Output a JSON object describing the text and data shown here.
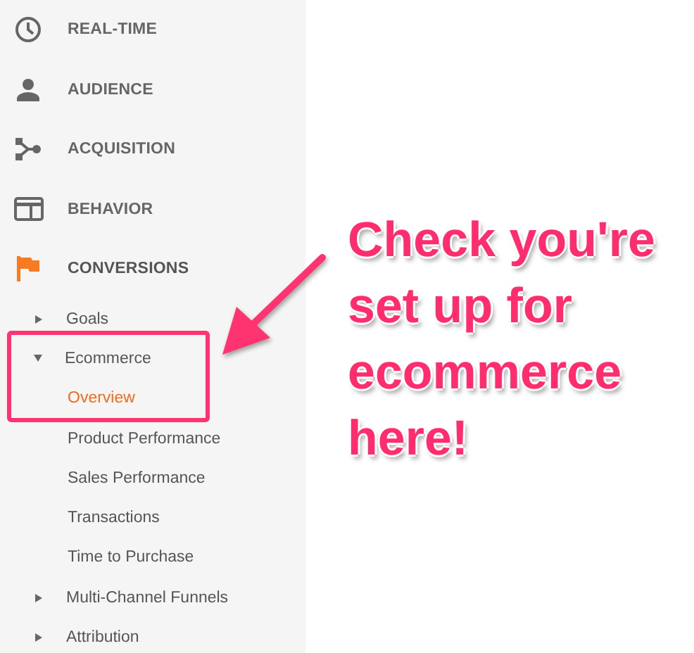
{
  "sidebar": {
    "sections": [
      {
        "label": "REAL-TIME",
        "kind": "clock",
        "selected": false
      },
      {
        "label": "AUDIENCE",
        "kind": "person",
        "selected": false
      },
      {
        "label": "ACQUISITION",
        "kind": "branch",
        "selected": false
      },
      {
        "label": "BEHAVIOR",
        "kind": "window",
        "selected": false
      },
      {
        "label": "CONVERSIONS",
        "kind": "flag",
        "selected": true
      }
    ],
    "items": [
      {
        "label": "Goals",
        "expanded": false
      },
      {
        "label": "Ecommerce",
        "expanded": true,
        "highlighted": true,
        "children": [
          {
            "label": "Overview",
            "selected": true
          },
          {
            "label": "Product Performance",
            "selected": false
          },
          {
            "label": "Sales Performance",
            "selected": false
          },
          {
            "label": "Transactions",
            "selected": false
          },
          {
            "label": "Time to Purchase",
            "selected": false
          }
        ]
      },
      {
        "label": "Multi-Channel Funnels",
        "expanded": false
      },
      {
        "label": "Attribution",
        "expanded": false
      }
    ]
  },
  "callout": {
    "lines": [
      "Check you're",
      "set up for",
      "ecommerce",
      "here!"
    ]
  }
}
